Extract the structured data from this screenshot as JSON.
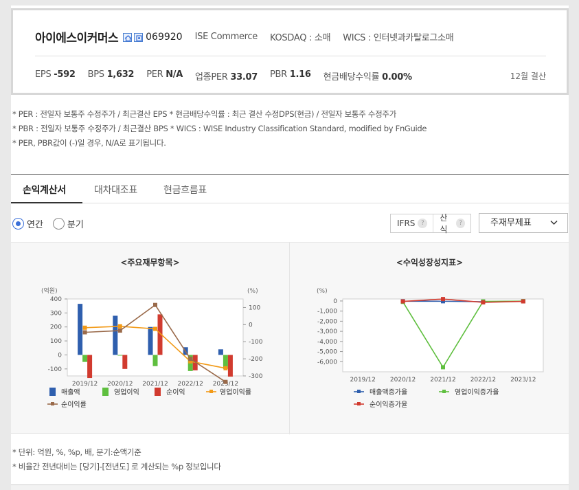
{
  "company": {
    "name": "아이에스이커머스",
    "code": "069920",
    "english_name": "ISE Commerce",
    "market": "KOSDAQ : 소매",
    "wics": "WICS : 인터넷과카탈로그소매",
    "icons": [
      "home-icon",
      "building-icon"
    ]
  },
  "stats": [
    {
      "label": "EPS",
      "value": "-592"
    },
    {
      "label": "BPS",
      "value": "1,632"
    },
    {
      "label": "PER",
      "value": "N/A"
    },
    {
      "label": "업종PER",
      "value": "33.07"
    },
    {
      "label": "PBR",
      "value": "1.16"
    },
    {
      "label": "현금배당수익률",
      "value": "0.00%"
    }
  ],
  "settlement": "12월 결산",
  "notes": [
    "* PER : 전일자 보통주 수정주가 / 최근결산 EPS * 현금배당수익률 : 최근 결산 수정DPS(현금) / 전일자 보통주 수정주가",
    "* PBR : 전일자 보통주 수정주가 / 최근결산 BPS * WICS : WISE Industry Classification Standard, modified by FnGuide",
    "* PER, PBR값이 (-)일 경우, N/A로 표기됩니다."
  ],
  "tabs": [
    {
      "label": "손익계산서",
      "active": true
    },
    {
      "label": "대차대조표",
      "active": false
    },
    {
      "label": "현금흐름표",
      "active": false
    }
  ],
  "period_options": [
    {
      "label": "연간",
      "checked": true
    },
    {
      "label": "분기",
      "checked": false
    }
  ],
  "toggles": [
    {
      "label": "IFRS",
      "help": "?"
    },
    {
      "label": "산식",
      "help": "?"
    }
  ],
  "select": {
    "value": "주재무제표"
  },
  "bottom_notes": [
    "* 단위: 억원, %, %p, 배, 분기:순액기준",
    "* 비율간 전년대비는 [당기]-[전년도] 로 계산되는 %p 정보입니다"
  ],
  "colors": {
    "blue": "#2f5fae",
    "green": "#5fbf3f",
    "red": "#d13b2f",
    "orange": "#f29a17",
    "brown": "#9a6a4a"
  },
  "chart_data": [
    {
      "type": "bar",
      "title": "<주요재무항목>",
      "ylabel_left": "(억원)",
      "ylabel_right": "(%)",
      "categories": [
        "2019/12",
        "2020/12",
        "2021/12",
        "2022/12",
        "2023/12"
      ],
      "ylim_left": [
        -150,
        400
      ],
      "yticks_left": [
        "400",
        "300",
        "200",
        "100",
        "0",
        "-100"
      ],
      "ylim_right": [
        -300,
        150
      ],
      "yticks_right": [
        "100",
        "0",
        "-100",
        "-200",
        "-300"
      ],
      "series": [
        {
          "name": "매출액",
          "kind": "bar",
          "axis": "left",
          "color": "#2f5fae",
          "values": [
            365,
            280,
            200,
            55,
            40
          ]
        },
        {
          "name": "영업이익",
          "kind": "bar",
          "axis": "left",
          "color": "#5fbf3f",
          "values": [
            -50,
            -5,
            -80,
            -115,
            -100
          ]
        },
        {
          "name": "순이익",
          "kind": "bar",
          "axis": "left",
          "color": "#d13b2f",
          "values": [
            -165,
            -100,
            290,
            -110,
            -155
          ]
        },
        {
          "name": "영업이익률",
          "kind": "line",
          "axis": "right",
          "color": "#f29a17",
          "values": [
            -18,
            -10,
            -25,
            -215,
            -255
          ]
        },
        {
          "name": "순이익률",
          "kind": "line",
          "axis": "right",
          "color": "#9a6a4a",
          "values": [
            -45,
            -35,
            115,
            -200,
            -335
          ]
        }
      ],
      "legend": "bottom"
    },
    {
      "type": "line",
      "title": "<수익성장성지표>",
      "ylabel": "(%)",
      "categories": [
        "2019/12",
        "2020/12",
        "2021/12",
        "2022/12",
        "2023/12"
      ],
      "ylim": [
        -7000,
        200
      ],
      "yticks": [
        "0",
        "-1,000",
        "-2,000",
        "-3,000",
        "-4,000",
        "-5,000",
        "-6,000"
      ],
      "series": [
        {
          "name": "매출액증가율",
          "color": "#2f5fae",
          "values": [
            null,
            -23,
            -29,
            -72,
            -27
          ]
        },
        {
          "name": "영업이익증가율",
          "color": "#5fbf3f",
          "values": [
            null,
            -90,
            -6550,
            -44,
            -13
          ]
        },
        {
          "name": "순이익증가율",
          "color": "#d13b2f",
          "values": [
            null,
            -40,
            190,
            -138,
            -40
          ]
        }
      ],
      "legend": "bottom"
    }
  ]
}
